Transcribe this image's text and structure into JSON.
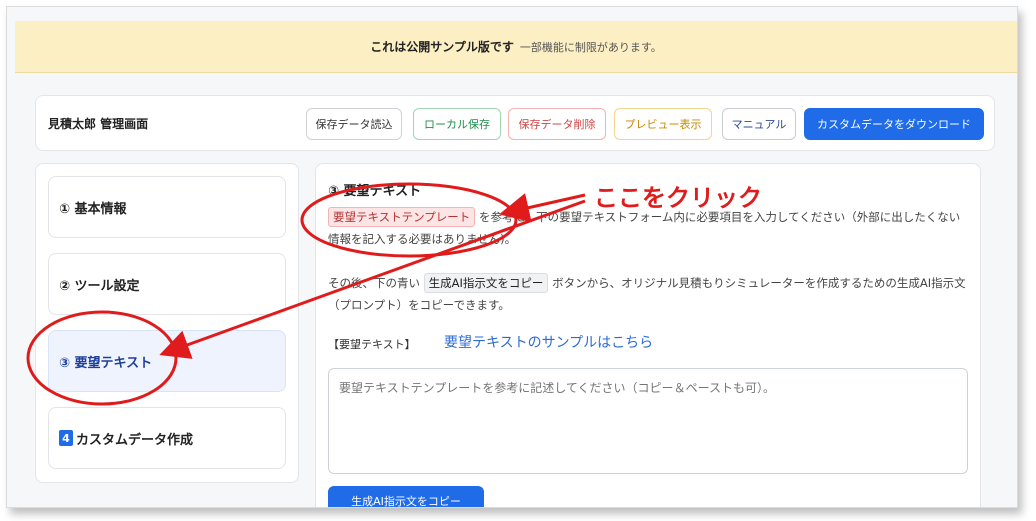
{
  "banner": {
    "bold": "これは公開サンプル版です",
    "rest": "一部機能に制限があります。"
  },
  "header": {
    "title": "見積太郎 管理画面",
    "buttons": {
      "load": "保存データ読込",
      "local_save": "ローカル保存",
      "delete": "保存データ削除",
      "preview": "プレビュー表示",
      "manual": "マニュアル",
      "download": "カスタムデータをダウンロード"
    }
  },
  "sidebar": {
    "items": [
      {
        "label": "① 基本情報"
      },
      {
        "label": "② ツール設定"
      },
      {
        "label": "③ 要望テキスト"
      },
      {
        "num": "4",
        "label": "カスタムデータ作成"
      }
    ]
  },
  "main": {
    "title": "③ 要望テキスト",
    "p1": {
      "chip": "要望テキストテンプレート",
      "text": "を参考に、下の要望テキストフォーム内に必要項目を入力してください（外部に出したくない情報を記入する必要はありません)。"
    },
    "p2": {
      "before": "その後、下の青い",
      "chip": "生成AI指示文をコピー",
      "after": "ボタンから、オリジナル見積もりシミュレーターを作成するための生成AI指示文（プロンプト）をコピーできます。"
    },
    "request_label": "【要望テキスト】",
    "sample_link": "要望テキストのサンプルはこちら",
    "textarea_placeholder": "要望テキストテンプレートを参考に記述してください（コピー＆ペーストも可）。",
    "copy_button": "生成AI指示文をコピー"
  },
  "annotation": {
    "label": "ここをクリック",
    "color": "#e01b1b"
  }
}
